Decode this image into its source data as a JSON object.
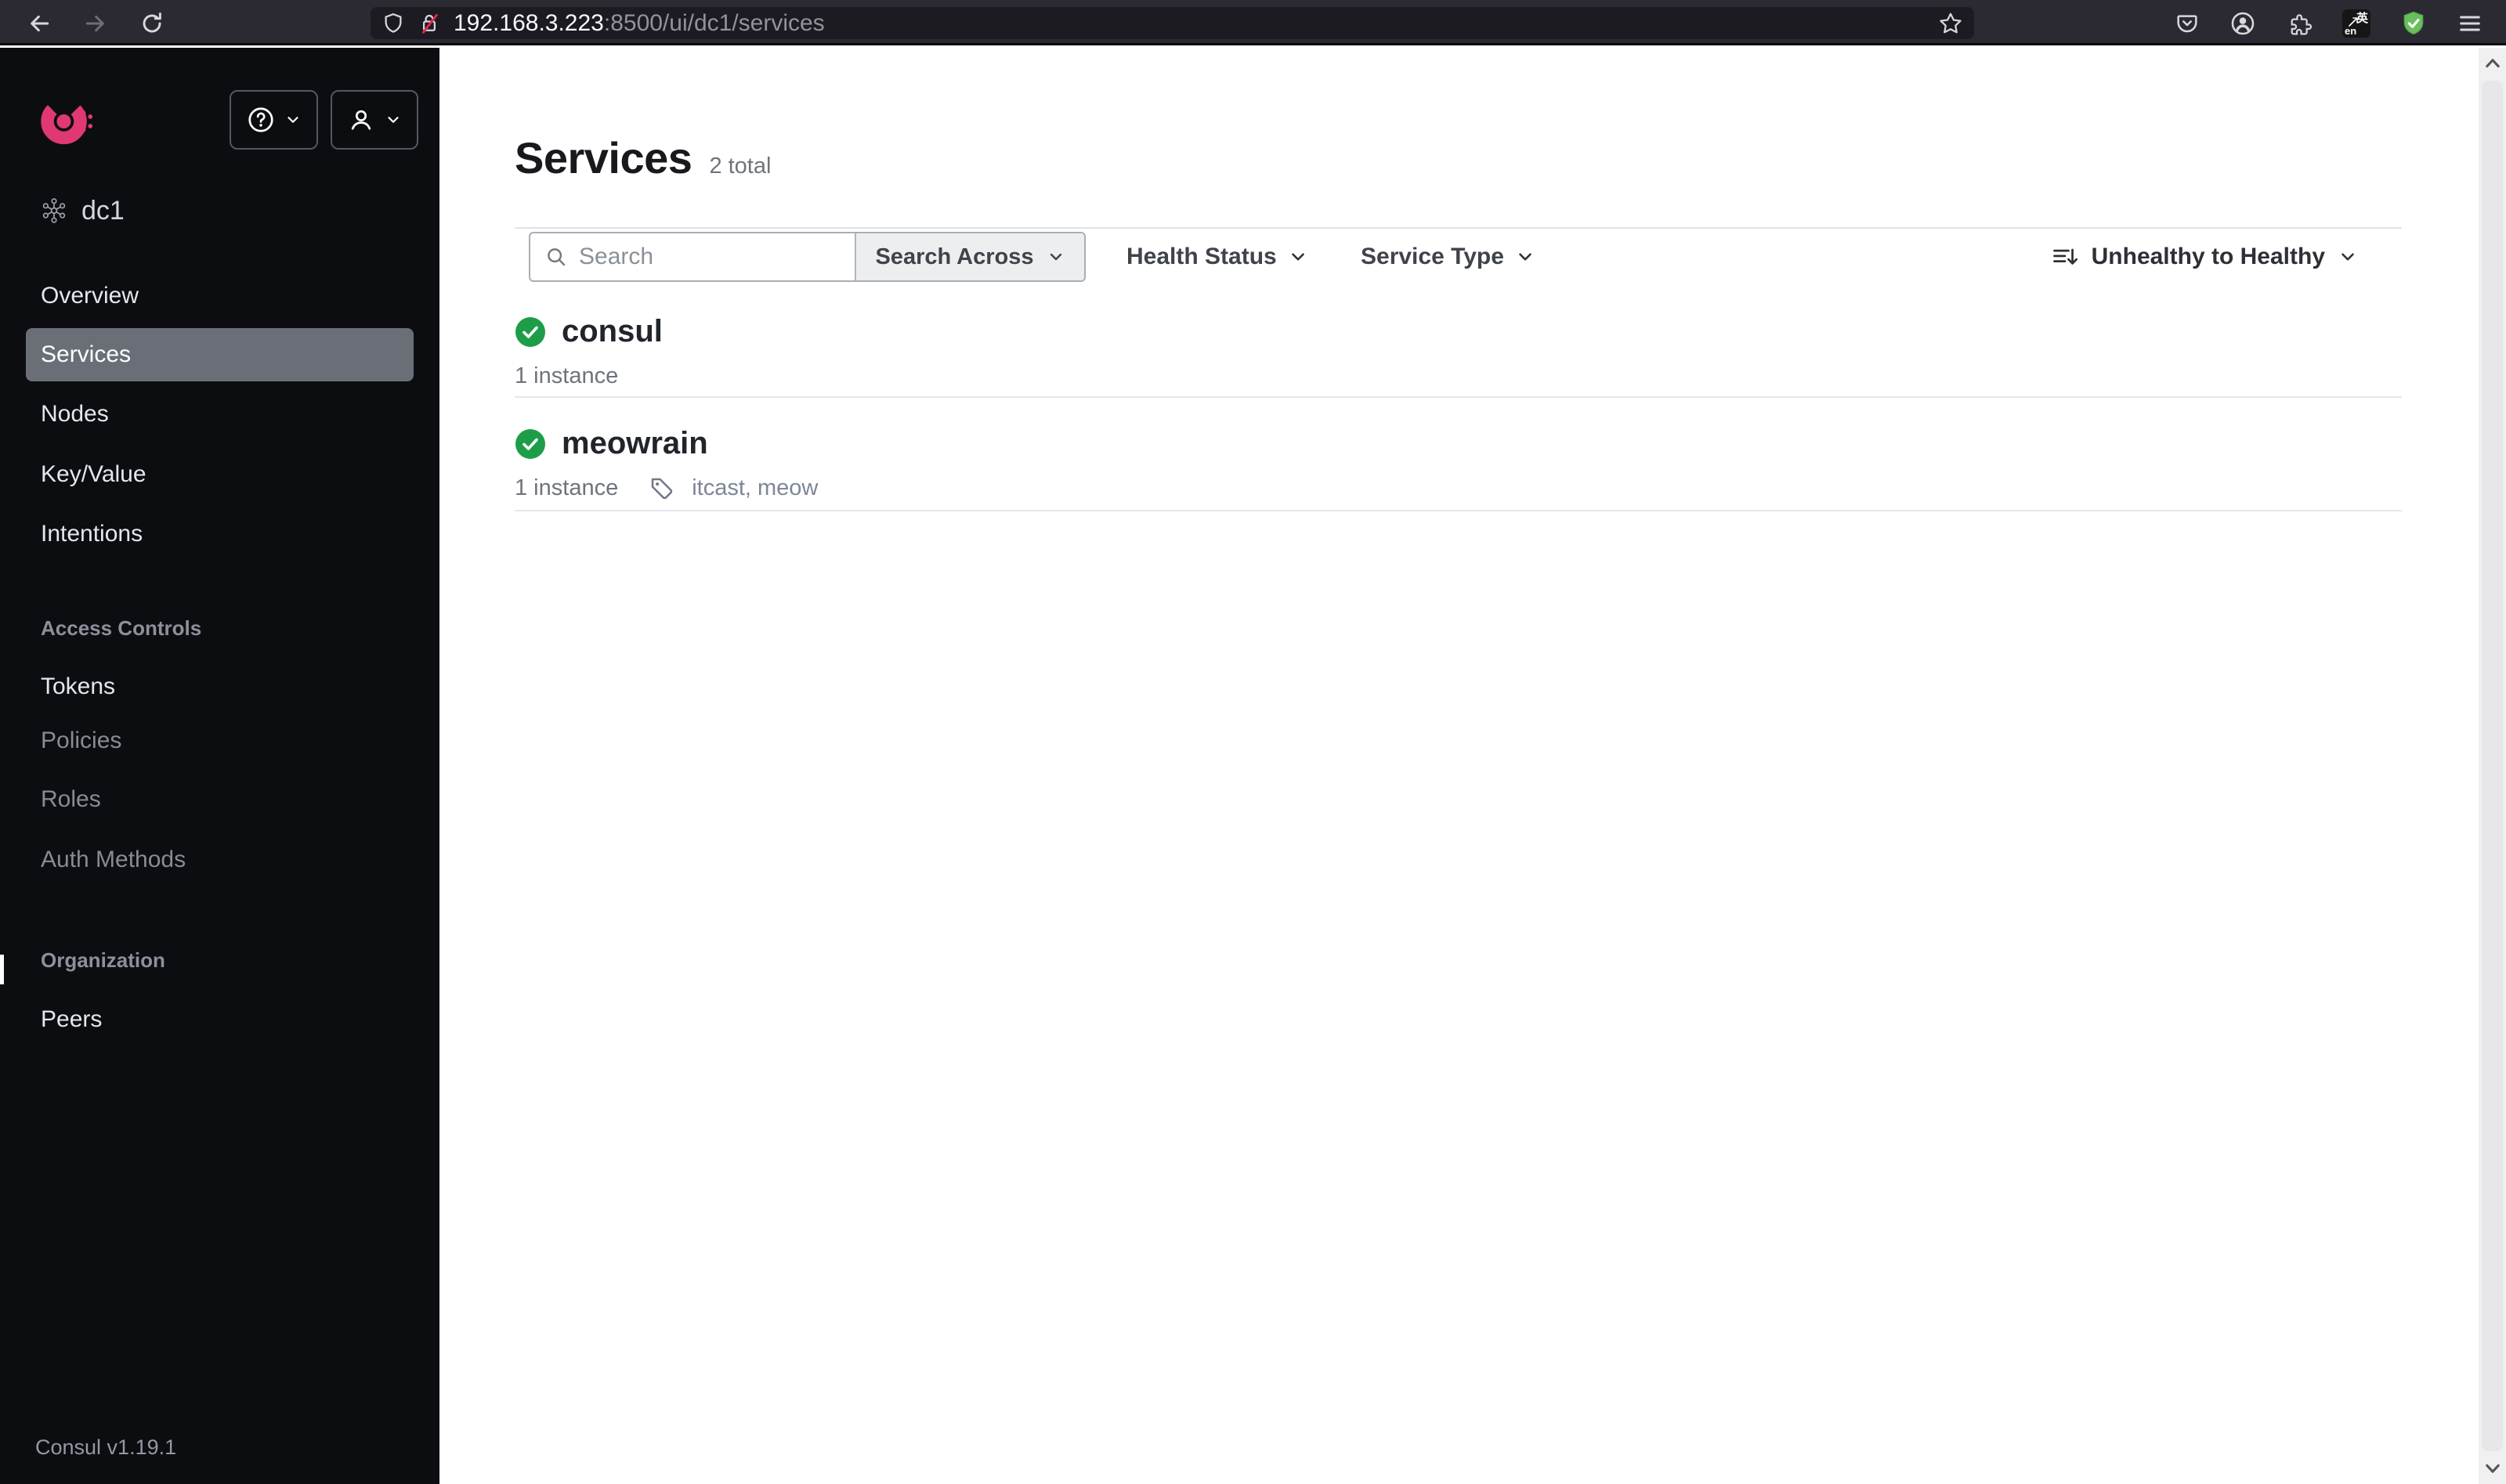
{
  "browser": {
    "url_host": "192.168.3.223",
    "url_path": ":8500/ui/dc1/services"
  },
  "sidebar": {
    "dc": "dc1",
    "nav": [
      {
        "label": "Overview"
      },
      {
        "label": "Services"
      },
      {
        "label": "Nodes"
      },
      {
        "label": "Key/Value"
      },
      {
        "label": "Intentions"
      }
    ],
    "access_header": "Access Controls",
    "acl": [
      {
        "label": "Tokens"
      },
      {
        "label": "Policies"
      },
      {
        "label": "Roles"
      },
      {
        "label": "Auth Methods"
      }
    ],
    "org_header": "Organization",
    "org": [
      {
        "label": "Peers"
      }
    ],
    "version": "Consul v1.19.1"
  },
  "main": {
    "title": "Services",
    "total": "2 total",
    "search_placeholder": "Search",
    "search_across": "Search Across",
    "health_status": "Health Status",
    "service_type": "Service Type",
    "sort_label": "Unhealthy to Healthy",
    "services": [
      {
        "name": "consul",
        "instances": "1 instance"
      },
      {
        "name": "meowrain",
        "instances": "1 instance",
        "tags": "itcast, meow"
      }
    ]
  },
  "colors": {
    "brand_pink": "#e03875",
    "healthy_green": "#1e9d49",
    "toolbar_bg": "#2b2a33",
    "sidebar_bg": "#0c0d10",
    "selected_nav_bg": "#6a6f77"
  }
}
